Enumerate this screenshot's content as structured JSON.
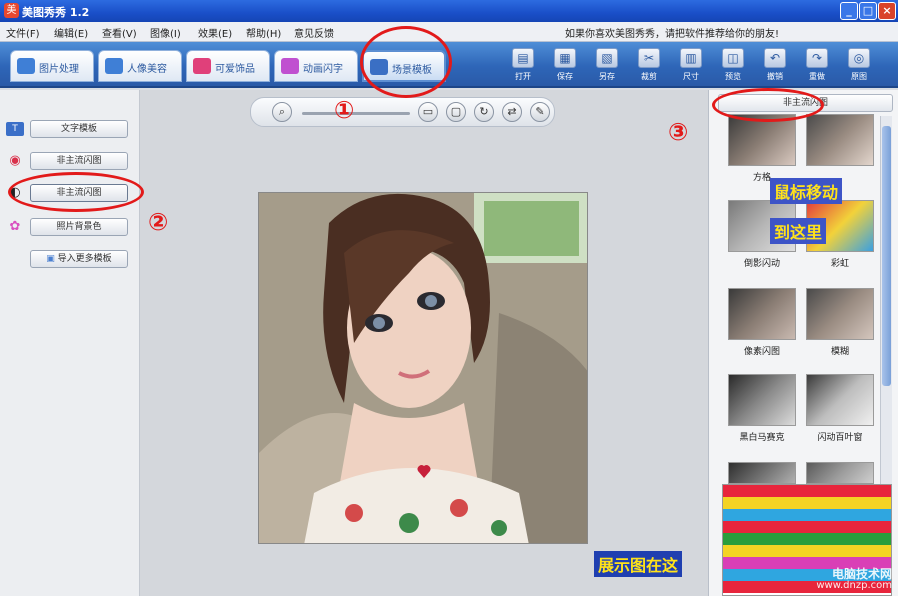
{
  "window": {
    "title": "美图秀秀 1.2",
    "controls": {
      "minimize": "_",
      "maximize": "□",
      "close": "×"
    }
  },
  "menu": {
    "items": [
      "文件(F)",
      "编辑(E)",
      "查看(V)",
      "图像(I)",
      "效果(E)",
      "帮助(H)",
      "意见反馈"
    ],
    "notice": "如果你喜欢美图秀秀，请把软件推荐给你的朋友!"
  },
  "tabs": [
    {
      "label": "图片处理",
      "icon_color": "#3f7fd6"
    },
    {
      "label": "人像美容",
      "icon_color": "#3f7fd6"
    },
    {
      "label": "可爱饰品",
      "icon_color": "#e0407a"
    },
    {
      "label": "动画闪字",
      "icon_color": "#c050d0"
    },
    {
      "label": "场景模板",
      "icon_color": "#3a6fc4",
      "active": true
    }
  ],
  "tools": [
    {
      "label": "打开",
      "icon": "open-icon",
      "glyph": "▤"
    },
    {
      "label": "保存",
      "icon": "save-icon",
      "glyph": "▦"
    },
    {
      "label": "另存",
      "icon": "save-as-icon",
      "glyph": "▧"
    },
    {
      "label": "裁剪",
      "icon": "crop-icon",
      "glyph": "✂"
    },
    {
      "label": "尺寸",
      "icon": "resize-icon",
      "glyph": "▥"
    },
    {
      "label": "预览",
      "icon": "preview-icon",
      "glyph": "◫"
    },
    {
      "label": "撤销",
      "icon": "undo-icon",
      "glyph": "↶"
    },
    {
      "label": "重做",
      "icon": "redo-icon",
      "glyph": "↷"
    },
    {
      "label": "原图",
      "icon": "original-icon",
      "glyph": "◎"
    }
  ],
  "left_panel": {
    "buttons": [
      {
        "label": "文字模板",
        "icon": "text-template-icon",
        "icon_color": "#3b6fc8"
      },
      {
        "label": "非主流闪图",
        "icon": "lips-icon",
        "icon_color": "#d9304a"
      },
      {
        "label": "非主流闪图",
        "icon": "flash-icon",
        "icon_color": "#222222",
        "active": true
      },
      {
        "label": "照片背景色",
        "icon": "flower-icon",
        "icon_color": "#d94fc0"
      },
      {
        "label": "导入更多模板",
        "icon": "import-icon",
        "icon_color": "#4a7fd0"
      }
    ]
  },
  "zoom": {
    "icons": [
      "zoom-icon",
      "fit-icon",
      "actual-size-icon",
      "rotate-icon",
      "flip-icon",
      "brush-icon"
    ],
    "glyphs": [
      "⌕",
      "▭",
      "▢",
      "↻",
      "⇄",
      "✎"
    ]
  },
  "right_panel": {
    "header": "非主流闪图",
    "thumbs": [
      {
        "label": "方格",
        "colors": [
          "#3a3a3a",
          "#8a7d74",
          "#d9c9c0"
        ]
      },
      {
        "label": "",
        "colors": [
          "#4a4a4a",
          "#9a8c82",
          "#e3d6cd"
        ]
      },
      {
        "label": "倒影闪动",
        "colors": [
          "#7a7a7a",
          "#b5b5b5",
          "#e0e0e0"
        ]
      },
      {
        "label": "彩虹",
        "colors": [
          "#e23b3b",
          "#f2d23a",
          "#3aa0e2"
        ]
      },
      {
        "label": "像素闪图",
        "colors": [
          "#3a3a3a",
          "#8a7d74",
          "#c9b9b0"
        ]
      },
      {
        "label": "模糊",
        "colors": [
          "#4a4a4a",
          "#9a8c82",
          "#d4c6bd"
        ]
      },
      {
        "label": "黑白马赛克",
        "colors": [
          "#2a2a2a",
          "#8a8a8a",
          "#dcdcdc"
        ]
      },
      {
        "label": "闪动百叶窗",
        "colors": [
          "#3a3a3a",
          "#bdbdbd",
          "#f0f0f0"
        ]
      },
      {
        "label": "",
        "colors": [
          "#2f2f2f",
          "#6f6f6f",
          "#b0b0b0"
        ]
      },
      {
        "label": "",
        "colors": [
          "#5a5a5a",
          "#9a9a9a",
          "#cfcfcf"
        ]
      }
    ]
  },
  "preview": {
    "stripes": [
      "#e8253c",
      "#f4d324",
      "#2fa6e0",
      "#e8253c",
      "#2a9d3c",
      "#f4d324",
      "#d93fb6",
      "#2fa6e0",
      "#e8253c"
    ]
  },
  "annotations": {
    "num1": "①",
    "num2": "②",
    "num3": "③",
    "mouse_hint_1": "鼠标移动",
    "mouse_hint_2": "到这里",
    "preview_hint": "展示图在这"
  },
  "watermark": {
    "line1": "电脑技术网",
    "line2": "www.dnzp.com"
  },
  "colors": {
    "accent": "#2e66b8",
    "annotation": "#e21a1a",
    "hint_text": "#ffe21a"
  }
}
